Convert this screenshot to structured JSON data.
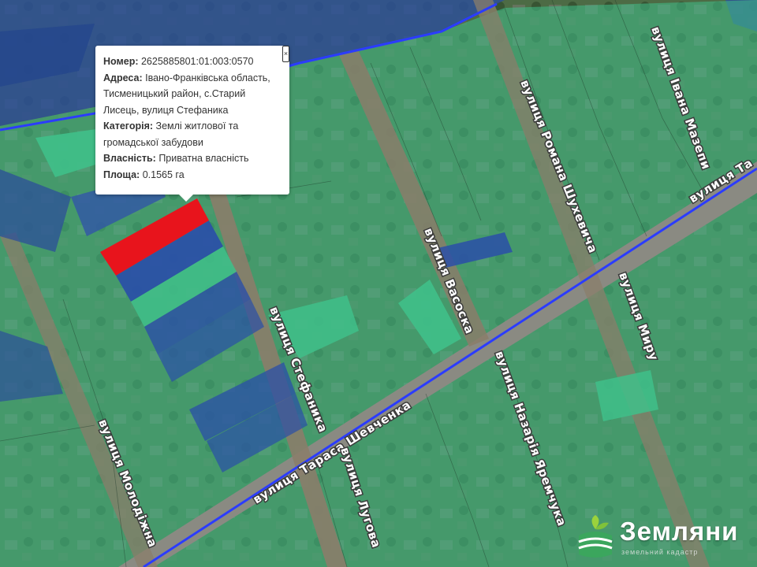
{
  "popup": {
    "number_label": "Номер:",
    "number_value": "2625885801:01:003:0570",
    "address_label": "Адреса:",
    "address_value": "Івано-Франківська область, Тисменицький район, с.Старий Лисець, вулиця Стефаника",
    "category_label": "Категорія:",
    "category_value": "Землі житлової та громадської забудови",
    "ownership_label": "Власність:",
    "ownership_value": "Приватна власність",
    "area_label": "Площа:",
    "area_value": "0.1565 га",
    "close_symbol": "×"
  },
  "streets": {
    "shevchenka": "вулиця Тараса Шевченка",
    "stefanyka": "вулиця Стефаника",
    "vasoka": "вулиця Васоска",
    "shukhevycha": "вулиця Романа Шухевича",
    "mazepy": "вулиця Івана Мазепи",
    "myru": "вулиця Миру",
    "nazariia": "вулиця Назарія Яремчука",
    "luhova": "вулиця Лугова",
    "molodizhna": "вулиця Молодіжна",
    "ta_fragment": "вулиця Та"
  },
  "logo": {
    "name": "Земляни",
    "tagline": "земельний кадастр"
  },
  "colors": {
    "parcel_green": "#3fc08a",
    "parcel_blue": "#2a4fa8",
    "selected_red": "#e8141c",
    "boundary_line": "#2b3cff"
  }
}
